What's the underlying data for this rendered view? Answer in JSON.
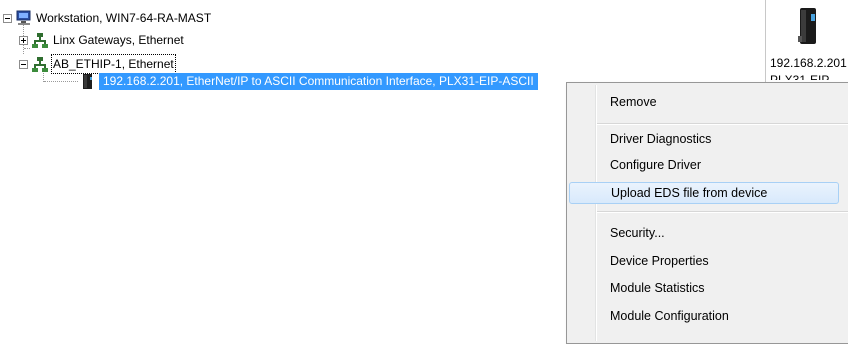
{
  "tree": {
    "workstation": {
      "label": "Workstation, WIN7-64-RA-MAST",
      "icon": "computer-icon",
      "expanded": true
    },
    "linx_gateways": {
      "label": "Linx Gateways, Ethernet",
      "icon": "network-icon",
      "expanded": false
    },
    "ab_ethip": {
      "label": "AB_ETHIP-1, Ethernet",
      "icon": "network-icon",
      "expanded": true
    },
    "device": {
      "label": "192.168.2.201, EtherNet/IP to ASCII Communication Interface, PLX31-EIP-ASCII",
      "icon": "device-module-icon"
    }
  },
  "right_pane": {
    "device_ip": "192.168.2.201",
    "device_name": "PLX31-EIP"
  },
  "context_menu": {
    "items": [
      {
        "label": "Remove"
      },
      {
        "label": "Driver Diagnostics"
      },
      {
        "label": "Configure Driver"
      },
      {
        "label": "Upload EDS file from device",
        "highlighted": true
      },
      {
        "label": "Security..."
      },
      {
        "label": "Device Properties"
      },
      {
        "label": "Module Statistics"
      },
      {
        "label": "Module Configuration"
      }
    ]
  },
  "colors": {
    "selection": "#3399ff",
    "menu_background": "#f0f0f0",
    "menu_hover": "#dcebfc"
  }
}
